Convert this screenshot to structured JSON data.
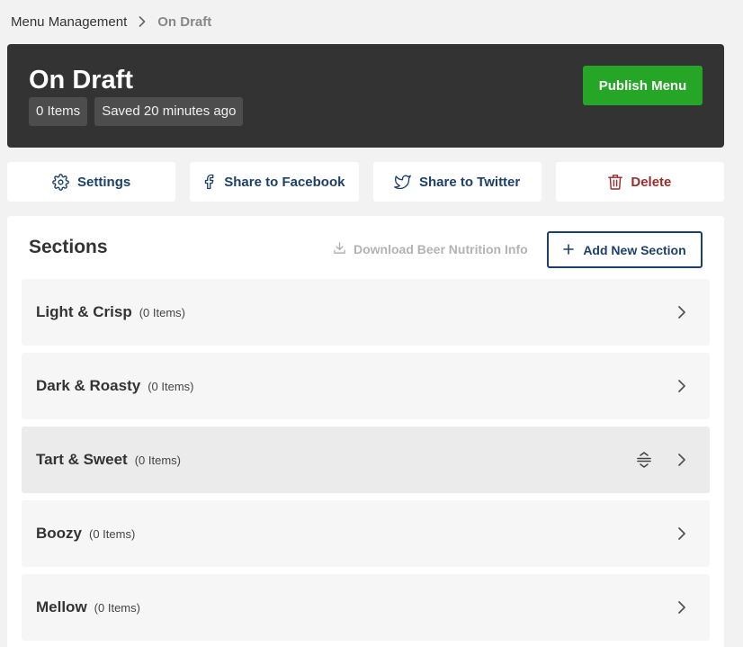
{
  "breadcrumb": {
    "parent": "Menu Management",
    "current": "On Draft"
  },
  "header": {
    "title": "On Draft",
    "items_badge": "0 Items",
    "saved_badge": "Saved 20 minutes ago",
    "publish_label": "Publish Menu"
  },
  "actions": {
    "settings": "Settings",
    "facebook": "Share to Facebook",
    "twitter": "Share to Twitter",
    "delete": "Delete"
  },
  "sections": {
    "title": "Sections",
    "download_label": "Download Beer Nutrition Info",
    "add_label": "Add New Section",
    "items": [
      {
        "name": "Light & Crisp",
        "count": "(0 Items)"
      },
      {
        "name": "Dark & Roasty",
        "count": "(0 Items)"
      },
      {
        "name": "Tart & Sweet",
        "count": "(0 Items)"
      },
      {
        "name": "Boozy",
        "count": "(0 Items)"
      },
      {
        "name": "Mellow",
        "count": "(0 Items)"
      }
    ]
  },
  "colors": {
    "header_bg": "#333333",
    "publish_green": "#26a626",
    "primary_blue": "#1d3f6b",
    "danger_red": "#9b2c2c"
  },
  "icons": [
    "chevron-right-icon",
    "gear-icon",
    "facebook-icon",
    "twitter-icon",
    "trash-icon",
    "download-icon",
    "plus-icon",
    "drag-handle-icon"
  ]
}
